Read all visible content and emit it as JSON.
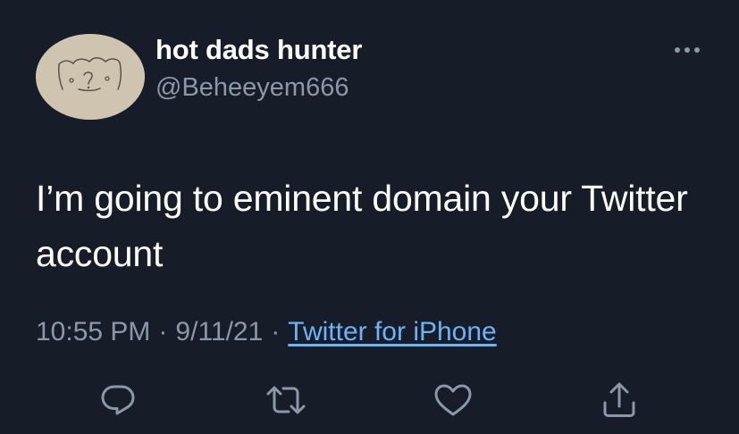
{
  "author": {
    "display_name": "hot dads hunter",
    "handle": "@Beheeyem666"
  },
  "tweet": {
    "text": "I’m going to eminent domain your Twitter account"
  },
  "meta": {
    "time": "10:55 PM",
    "separator": "·",
    "date": "9/11/21",
    "source": "Twitter for iPhone"
  },
  "icons": {
    "more": "more-horizontal-icon",
    "reply": "reply-icon",
    "retweet": "retweet-icon",
    "like": "heart-icon",
    "share": "share-icon"
  },
  "colors": {
    "background": "#161d29",
    "primary_text": "#ffffff",
    "secondary_text": "#8b98a5",
    "link": "#6bb4f5"
  }
}
